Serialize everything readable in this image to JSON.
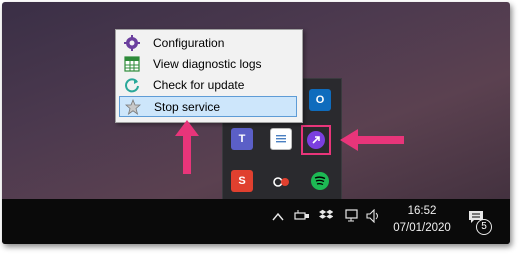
{
  "context_menu": {
    "items": [
      {
        "label": "Configuration",
        "icon": "gear-icon"
      },
      {
        "label": "View diagnostic logs",
        "icon": "log-grid-icon"
      },
      {
        "label": "Check for update",
        "icon": "refresh-icon"
      },
      {
        "label": "Stop service",
        "icon": "star-icon",
        "selected": true
      }
    ]
  },
  "tray_overflow": {
    "icons": [
      "outlook-icon",
      "teams-icon",
      "notepad-icon",
      "app-arrow-icon",
      "snagit-icon",
      "camera-icon",
      "spotify-icon"
    ],
    "outlook_letter": "O",
    "teams_letter": "T",
    "snagit_letter": "S"
  },
  "taskbar": {
    "time": "16:52",
    "date": "07/01/2020",
    "notification_count": "5"
  },
  "colors": {
    "highlight": "#e8357a",
    "menu_selected": "#cde6fb",
    "app_purple": "#7b3fe0"
  }
}
